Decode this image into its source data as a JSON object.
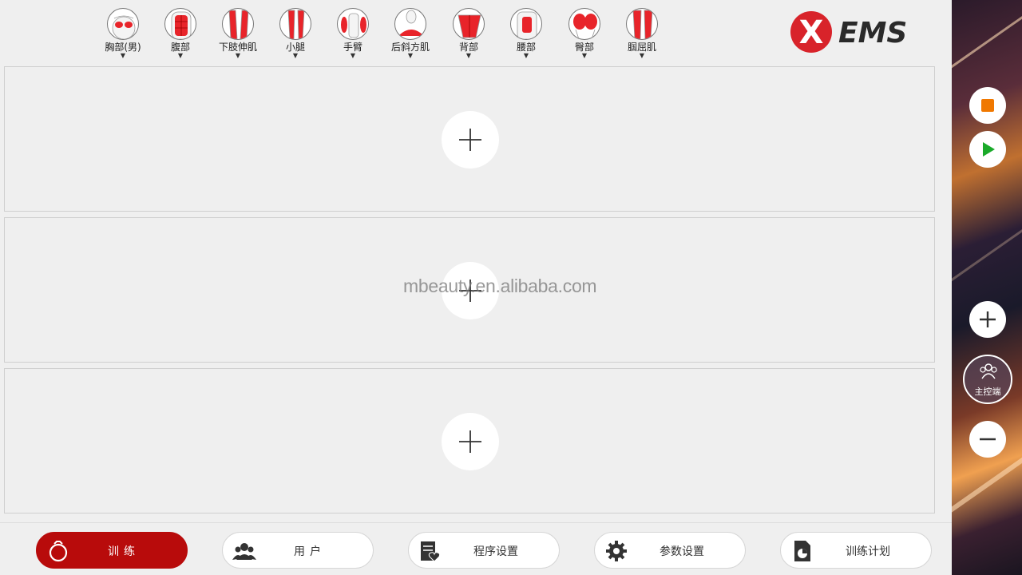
{
  "muscle_groups": [
    {
      "label": "胸部(男)"
    },
    {
      "label": "腹部"
    },
    {
      "label": "下肢伸肌"
    },
    {
      "label": "小腿"
    },
    {
      "label": "手臂"
    },
    {
      "label": "后斜方肌"
    },
    {
      "label": "背部"
    },
    {
      "label": "腰部"
    },
    {
      "label": "臀部"
    },
    {
      "label": "腘屈肌"
    }
  ],
  "logo": {
    "text": "EMS",
    "mark": "X"
  },
  "watermark": "mbeauty.en.alibaba.com",
  "channels": [
    {
      "icon": "plus-icon"
    },
    {
      "icon": "plus-icon"
    },
    {
      "icon": "plus-icon"
    }
  ],
  "bottom_nav": [
    {
      "label": "训练",
      "icon": "ring-icon",
      "active": true
    },
    {
      "label": "用户",
      "icon": "users-icon"
    },
    {
      "label": "程序设置",
      "icon": "program-icon"
    },
    {
      "label": "参数设置",
      "icon": "gear-icon"
    },
    {
      "label": "训练计划",
      "icon": "plan-icon"
    }
  ],
  "sidebar": {
    "stop_icon": "stop-icon",
    "play_icon": "play-icon",
    "increase_icon": "plus-icon",
    "master_label": "主控端",
    "decrease_icon": "minus-icon"
  },
  "colors": {
    "accent_red": "#b80b0b",
    "stop_orange": "#f07800",
    "play_green": "#1aaa2a",
    "muscle_red": "#e8242a"
  }
}
